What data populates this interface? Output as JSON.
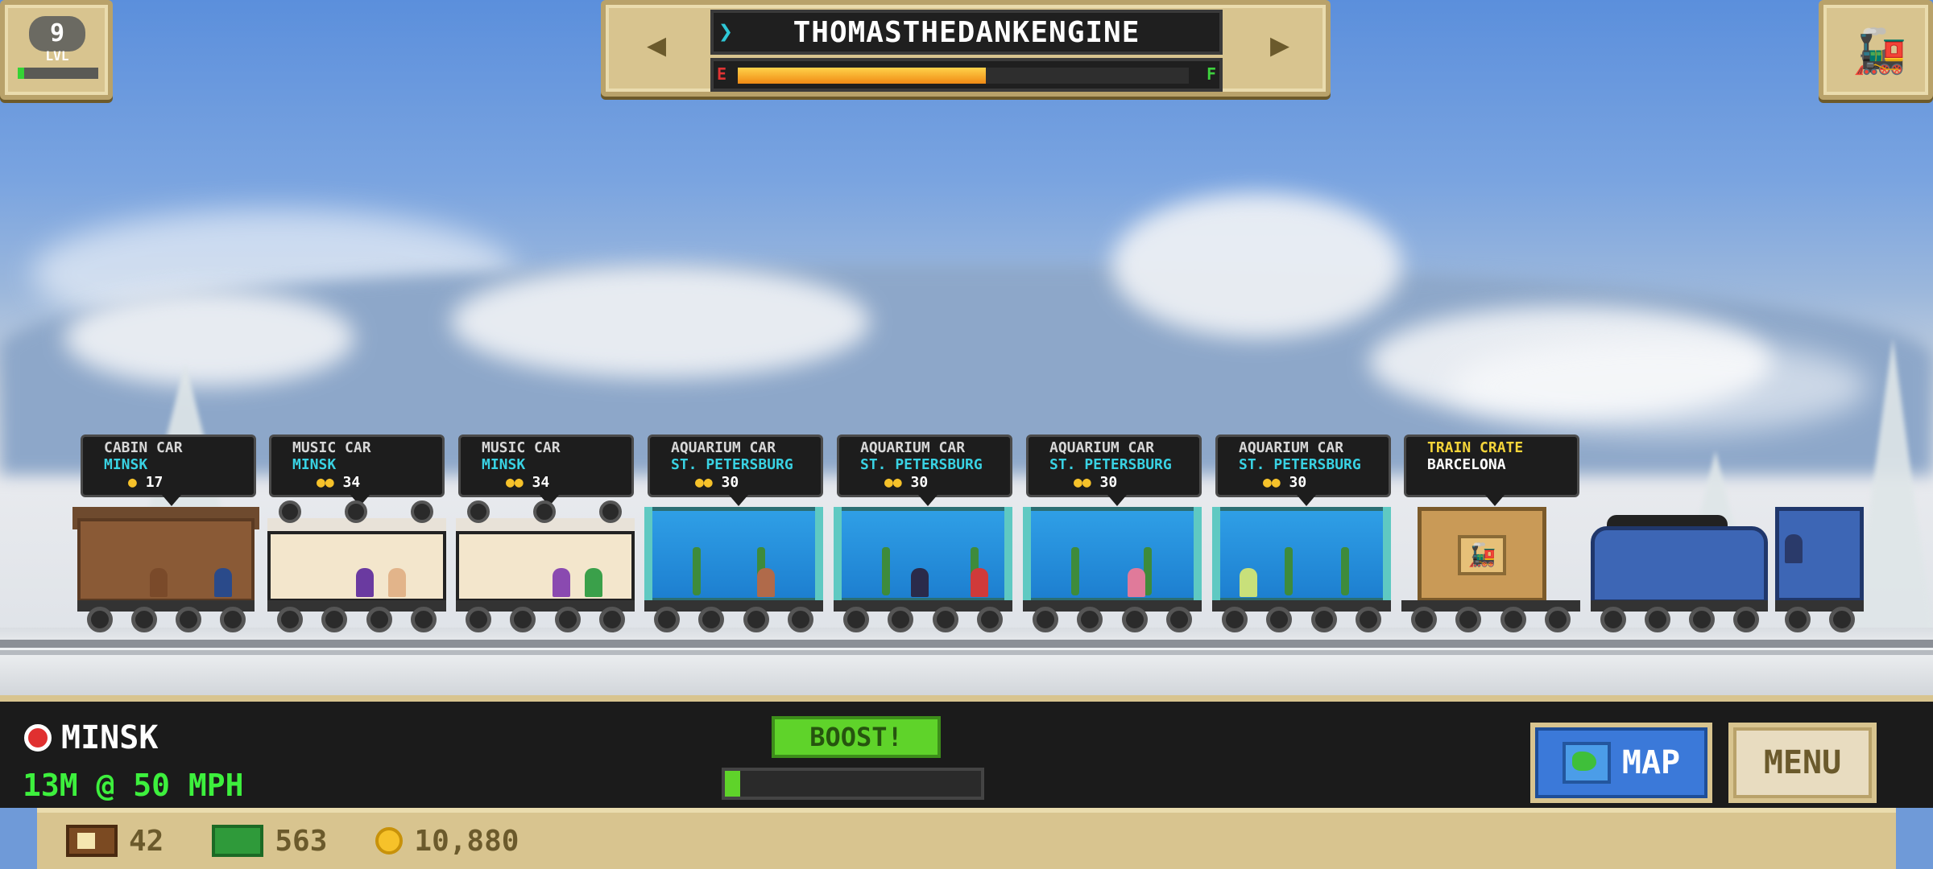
{
  "colors": {
    "accent_green": "#3df03d",
    "gold_panel": "#d8c48f",
    "aqua_text": "#39d2e3",
    "crate_yellow": "#f5d53a"
  },
  "level": {
    "number": "9",
    "label": "LVL",
    "progress": 0.08
  },
  "engine": {
    "name": "THOMASTHEDANKENGINE",
    "fuel_empty_label": "E",
    "fuel_full_label": "F",
    "fuel_level": 0.55,
    "prev_icon": "arrow-left-icon",
    "next_icon": "arrow-right-icon"
  },
  "train_button": {
    "icon": "train-icon"
  },
  "cars": [
    {
      "type": "CABIN CAR",
      "destination": "MINSK",
      "fare": "17"
    },
    {
      "type": "MUSIC CAR",
      "destination": "MINSK",
      "fare": "34"
    },
    {
      "type": "MUSIC CAR",
      "destination": "MINSK",
      "fare": "34"
    },
    {
      "type": "AQUARIUM CAR",
      "destination": "ST. PETERSBURG",
      "fare": "30"
    },
    {
      "type": "AQUARIUM CAR",
      "destination": "ST. PETERSBURG",
      "fare": "30"
    },
    {
      "type": "AQUARIUM CAR",
      "destination": "ST. PETERSBURG",
      "fare": "30"
    },
    {
      "type": "AQUARIUM CAR",
      "destination": "ST. PETERSBURG",
      "fare": "30"
    },
    {
      "type": "TRAIN CRATE",
      "destination": "BARCELONA"
    }
  ],
  "hud": {
    "location": "MINSK",
    "speed": "13M @ 50 MPH",
    "boost_label": "BOOST!",
    "boost_level": 0.06,
    "map_label": "MAP",
    "menu_label": "MENU"
  },
  "currency": {
    "bux": "42",
    "cash": "563",
    "coins": "10,880"
  }
}
